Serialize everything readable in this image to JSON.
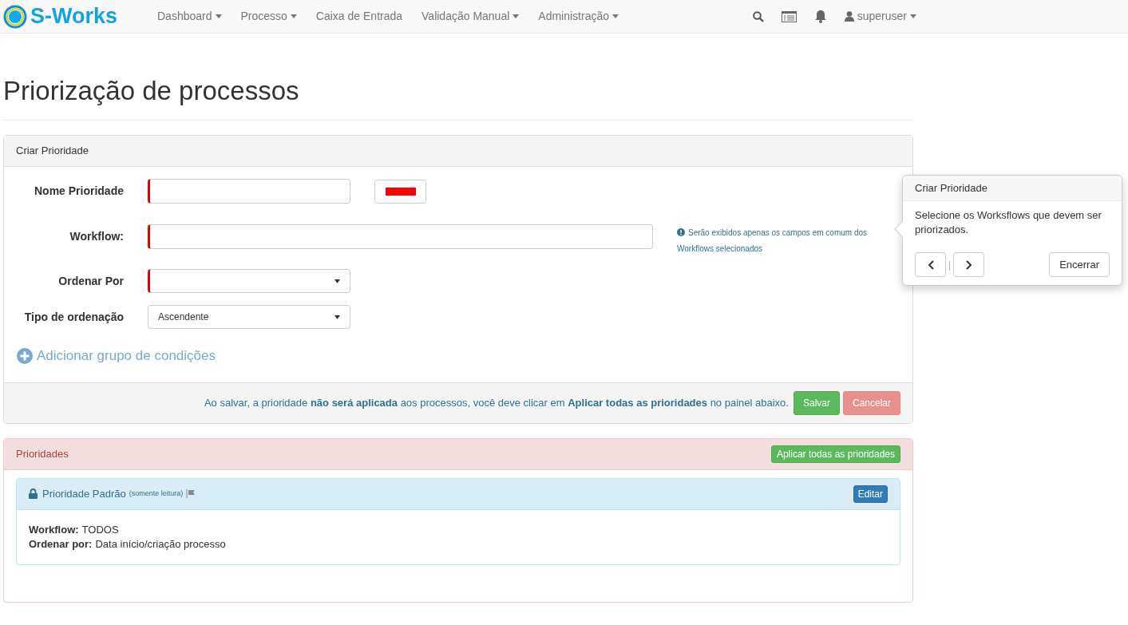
{
  "navbar": {
    "brand": "S-Works",
    "menu": [
      {
        "label": "Dashboard",
        "dropdown": true
      },
      {
        "label": "Processo",
        "dropdown": true
      },
      {
        "label": "Caixa de Entrada",
        "dropdown": false
      },
      {
        "label": "Validação Manual",
        "dropdown": true
      },
      {
        "label": "Administração",
        "dropdown": true
      }
    ],
    "user": "superuser"
  },
  "page_title": "Priorização de processos",
  "create_panel": {
    "title": "Criar Prioridade",
    "fields": [
      {
        "label": "Nome Prioridade",
        "kind": "text",
        "required": true,
        "color": "#ff0000"
      },
      {
        "label": "Workflow:",
        "kind": "wide",
        "required": true,
        "hint": "Serão exibidos apenas os campos em comum dos Workflows selecionados"
      },
      {
        "label": "Ordenar Por",
        "kind": "select",
        "required": true
      },
      {
        "label": "Tipo de ordenação",
        "kind": "select",
        "required": false,
        "value": "Ascendente"
      }
    ],
    "add_group": "Adicionar grupo de condições",
    "footer_note": "Ao salvar, a prioridade **não será aplicada** aos processos, você deve clicar em **Aplicar todas as prioridades** no painel abaixo.",
    "save": "Salvar",
    "cancel": "Cancelar"
  },
  "priorities_panel": {
    "title": "Prioridades",
    "apply": "Aplicar todas as prioridades",
    "items": [
      {
        "title": "Prioridade Padrão",
        "note": "(somente leitura)",
        "edit": "Editar",
        "lines": [
          {
            "label": "Workflow:",
            "value": "TODOS"
          },
          {
            "label": "Ordenar por:",
            "value": "Data início/criação processo"
          }
        ]
      }
    ]
  },
  "popover": {
    "title": "Criar Prioridade",
    "body": "Selecione os Worksflows que devem ser priorizados.",
    "separator": "|",
    "close": "Encerrar"
  }
}
